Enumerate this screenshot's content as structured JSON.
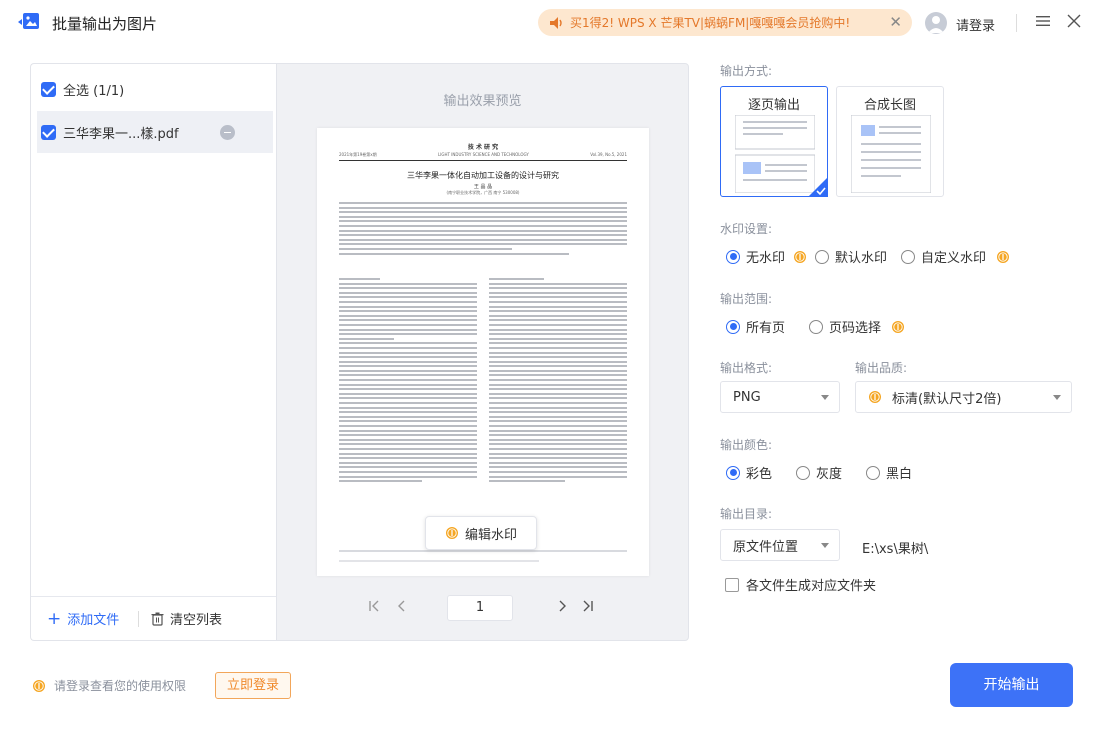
{
  "window": {
    "title": "批量输出为图片",
    "promo_text": "买1得2! WPS X 芒果TV|蜗蜗FM|嘎嘎嘎会员抢购中!",
    "login": "请登录"
  },
  "files": {
    "select_all": "全选 (1/1)",
    "items": [
      {
        "name": "三华李果一...樣.pdf"
      }
    ],
    "add_file": "添加文件",
    "clear_list": "清空列表"
  },
  "preview": {
    "title": "输出效果预览",
    "page_number": "1",
    "edit_watermark": "编辑水印",
    "doc": {
      "journal": "技 术 研 究",
      "issue_left": "2021年第19卷第x期",
      "issue_mid": "LIGHT INDUSTRY SCIENCE AND TECHNOLOGY",
      "issue_right": "Vol.39, No.5, 2021",
      "title": "三华李果一体化自动加工设备的设计与研究",
      "author": "王 晶 晶",
      "affiliation": "(南宁职业技术学院，广西 南宁 530008)"
    }
  },
  "settings": {
    "output_mode_label": "输出方式:",
    "mode_per_page": "逐页输出",
    "mode_long": "合成长图",
    "watermark_label": "水印设置:",
    "wm_none": "无水印",
    "wm_default": "默认水印",
    "wm_custom": "自定义水印",
    "range_label": "输出范围:",
    "range_all": "所有页",
    "range_select": "页码选择",
    "format_label": "输出格式:",
    "format_value": "PNG",
    "quality_label": "输出品质:",
    "quality_value": "标清(默认尺寸2倍)",
    "color_label": "输出颜色:",
    "color_color": "彩色",
    "color_gray": "灰度",
    "color_bw": "黑白",
    "dir_label": "输出目录:",
    "dir_value": "原文件位置",
    "dir_path": "E:\\xs\\果树\\",
    "subfolder": "各文件生成对应文件夹"
  },
  "footer": {
    "tip": "请登录查看您的使用权限",
    "login_now": "立即登录",
    "start": "开始输出"
  },
  "colors": {
    "accent": "#2f6bf6",
    "promo_bg": "#fde7cf",
    "promo_text": "#e4782a",
    "vip_coin": "#f5a623"
  }
}
